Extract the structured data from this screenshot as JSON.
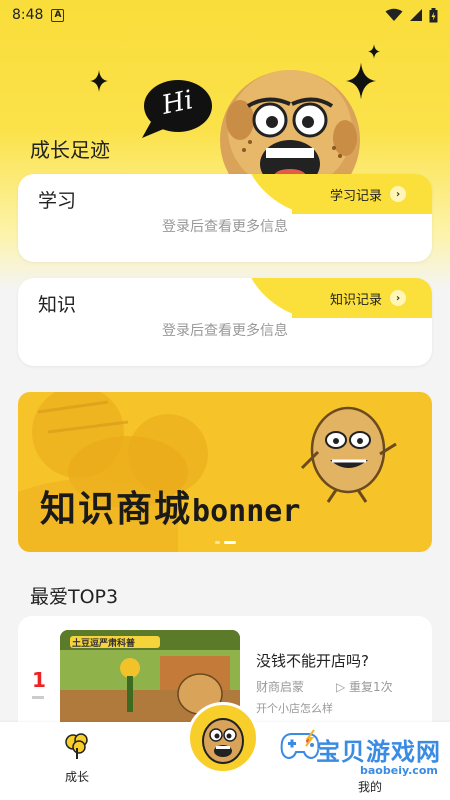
{
  "status_bar": {
    "time": "8:48",
    "notification_badge": "A"
  },
  "profile": {
    "section_title": "成长足迹",
    "hi_bubble": "Hi"
  },
  "study_card": {
    "title": "学习",
    "record_label": "学习记录",
    "hint": "登录后查看更多信息"
  },
  "knowledge_card": {
    "title": "知识",
    "record_label": "知识记录",
    "hint": "登录后查看更多信息"
  },
  "banner": {
    "text_cn": "知识商城",
    "text_latin": "bonner",
    "dot_count": 2,
    "active_dot": 1
  },
  "top3": {
    "title": "最爱TOP3",
    "items": [
      {
        "rank": "1",
        "thumb_sign": "土豆逗严肃科普",
        "title": "没钱不能开店吗?",
        "author": "财商启蒙",
        "replay": "重复1次",
        "desc": "开个小店怎么样"
      }
    ]
  },
  "bottom_nav": {
    "grow_label": "成长",
    "right_label": "我的"
  },
  "watermark": {
    "text": "宝贝游戏网",
    "url": "baobeiy.com"
  },
  "colors": {
    "brand_yellow": "#fbe03c",
    "rank_red": "#ee2222",
    "hint_gray": "#999999"
  },
  "icons": {
    "wifi": "wifi-icon",
    "signal": "signal-icon",
    "battery": "battery-icon",
    "chevron": "chevron-right-icon",
    "play": "play-icon",
    "tree": "tree-icon",
    "gamepad": "gamepad-icon"
  }
}
